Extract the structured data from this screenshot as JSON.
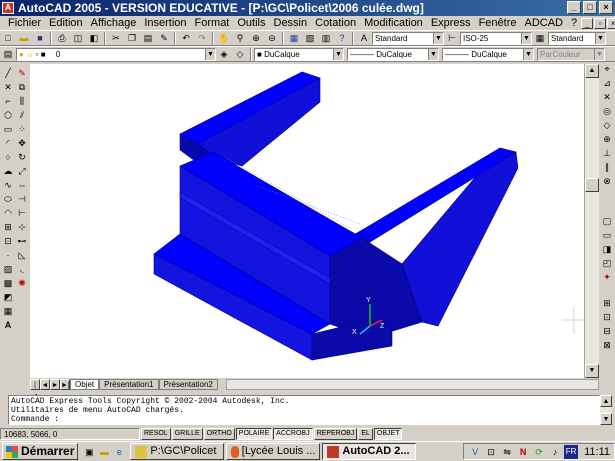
{
  "window": {
    "title": "AutoCAD 2005 - VERSION EDUCATIVE - [P:\\GC\\Policet\\2006 culée.dwg]",
    "minimize": "_",
    "maximize": "□",
    "close": "×"
  },
  "menu": {
    "items": [
      "Fichier",
      "Edition",
      "Affichage",
      "Insertion",
      "Format",
      "Outils",
      "Dessin",
      "Cotation",
      "Modification",
      "Express",
      "Fenêtre",
      "ADCAD",
      "?"
    ]
  },
  "toolbar": {
    "text_style": "Standard",
    "dim_style": "ISO-25",
    "table_style": "Standard"
  },
  "layers": {
    "current_layer": "0",
    "color": "DuCalque",
    "linetype": "DuCalque",
    "lineweight": "DuCalque",
    "plot_style": "ParCouleur"
  },
  "layout_tabs": {
    "model": "Objet",
    "layout1": "Présentation1",
    "layout2": "Présentation2"
  },
  "command_line": {
    "lines": [
      "AutoCAD Express Tools Copyright © 2002-2004 Autodesk, Inc.",
      "Utilitaires de menu AutoCAD chargés.",
      "Commande :"
    ]
  },
  "status": {
    "coordinates": "10683, 5066, 0",
    "buttons": [
      "RESOL",
      "GRILLE",
      "ORTHO",
      "POLAIRE",
      "ACCROBJ",
      "REPEROBJ",
      "EL",
      "OBJET"
    ],
    "active_buttons": [
      "POLAIRE",
      "ACCROBJ",
      "OBJET"
    ]
  },
  "taskbar": {
    "start_label": "Démarrer",
    "tasks": [
      "P:\\GC\\Policet",
      "[Lycée Louis ...",
      "AutoCAD 2..."
    ],
    "clock": "11:11"
  },
  "colors": {
    "model_face_front": "#1010d8",
    "model_face_top": "#0000ff",
    "model_face_side": "#0a0aa8",
    "title_bar": "#0a246a"
  }
}
